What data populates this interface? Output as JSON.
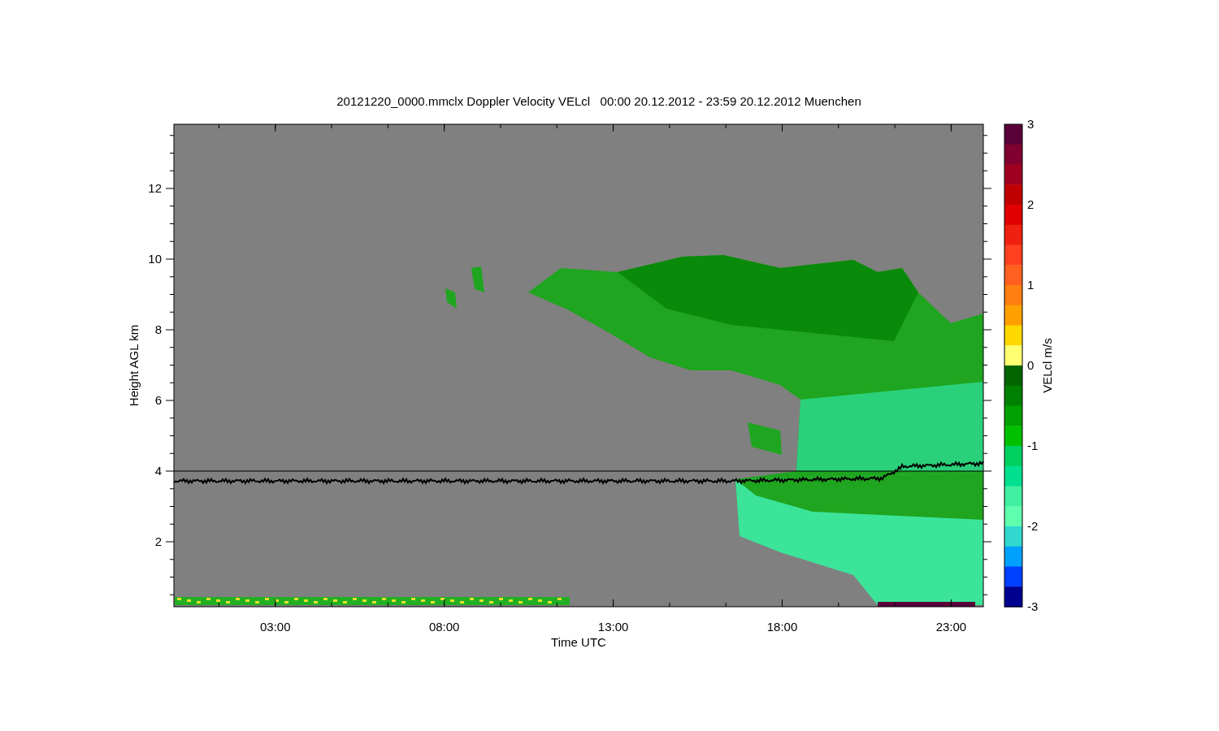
{
  "title": "20121220_0000.mmclx Doppler Velocity VELcl   00:00 20.12.2012 - 23:59 20.12.2012 Muenchen",
  "plot": {
    "xlabel": "Time UTC",
    "ylabel": "Height AGL km",
    "xtick_labels": [
      "03:00",
      "08:00",
      "13:00",
      "18:00",
      "23:00"
    ],
    "ytick_labels": [
      "12",
      "10",
      "8",
      "6",
      "4",
      "2"
    ]
  },
  "colorbar": {
    "label": "VELcl m/s",
    "tick_labels": [
      "3",
      "2",
      "1",
      "0",
      "-1",
      "-2",
      "-3"
    ],
    "steps": [
      {
        "color": "#5a0038"
      },
      {
        "color": "#800030"
      },
      {
        "color": "#a00020"
      },
      {
        "color": "#c00000"
      },
      {
        "color": "#e00000"
      },
      {
        "color": "#f02010"
      },
      {
        "color": "#ff4020"
      },
      {
        "color": "#ff6020"
      },
      {
        "color": "#ff8010"
      },
      {
        "color": "#ffa000"
      },
      {
        "color": "#ffd800"
      },
      {
        "color": "#ffff70"
      },
      {
        "color": "#006400"
      },
      {
        "color": "#008000"
      },
      {
        "color": "#00a000"
      },
      {
        "color": "#00c000"
      },
      {
        "color": "#00d060"
      },
      {
        "color": "#00e090"
      },
      {
        "color": "#40f0a0"
      },
      {
        "color": "#60ffb0"
      },
      {
        "color": "#30d8d0"
      },
      {
        "color": "#00a0ff"
      },
      {
        "color": "#0040ff"
      },
      {
        "color": "#000090"
      }
    ]
  }
}
